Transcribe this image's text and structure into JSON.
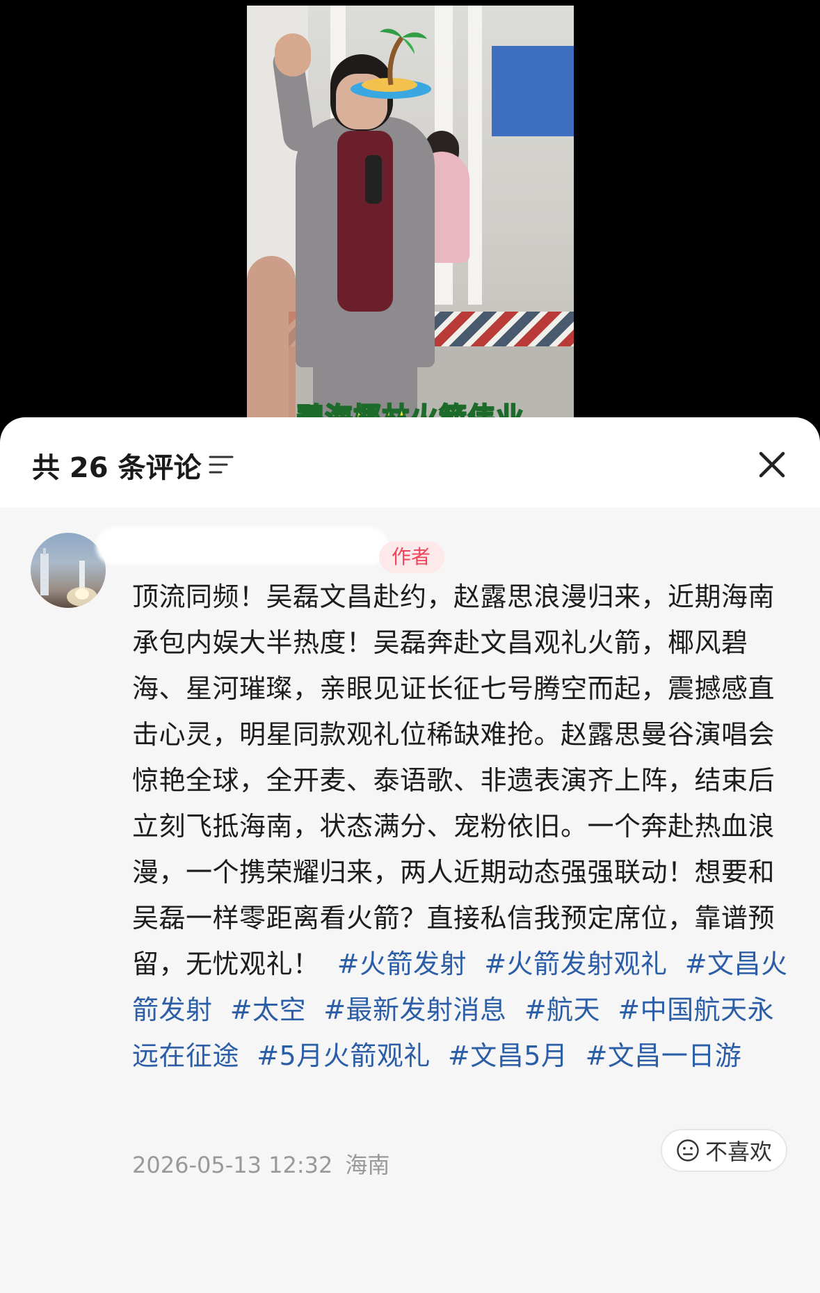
{
  "video": {
    "caption": "碧海椰林火箭伟业"
  },
  "comments_panel": {
    "title": "共 26 条评论",
    "sort_icon": "sort-icon",
    "close_icon": "close-icon"
  },
  "comment": {
    "author_badge": "作者",
    "text": "顶流同频！吴磊文昌赴约，赵露思浪漫归来，近期海南承包内娱大半热度！吴磊奔赴文昌观礼火箭，椰风碧海、星河璀璨，亲眼见证长征七号腾空而起，震撼感直击心灵，明星同款观礼位稀缺难抢。赵露思曼谷演唱会惊艳全球，全开麦、泰语歌、非遗表演齐上阵，结束后立刻飞抵海南，状态满分、宠粉依旧。一个奔赴热血浪漫，一个携荣耀归来，两人近期动态强强联动！想要和吴磊一样零距离看火箭？直接私信我预定席位，靠谱预留，无忧观礼！",
    "hashtags": [
      "#火箭发射",
      "#火箭发射观礼",
      "#文昌火箭发射",
      "#太空",
      "#最新发射消息",
      "#航天",
      "#中国航天永远在征途",
      "#5月火箭观礼",
      "#文昌5月",
      "#文昌一日游"
    ],
    "timestamp": "2026-05-13 12:32",
    "location": "海南",
    "dislike_label": "不喜欢",
    "dislike_icon": "neutral-face-icon"
  },
  "colors": {
    "hashtag": "#2b5ea6",
    "badge_text": "#f0455c",
    "badge_bg": "#fde8ea",
    "caption_fill": "#f2e23a",
    "caption_stroke": "#1c6b2a"
  }
}
